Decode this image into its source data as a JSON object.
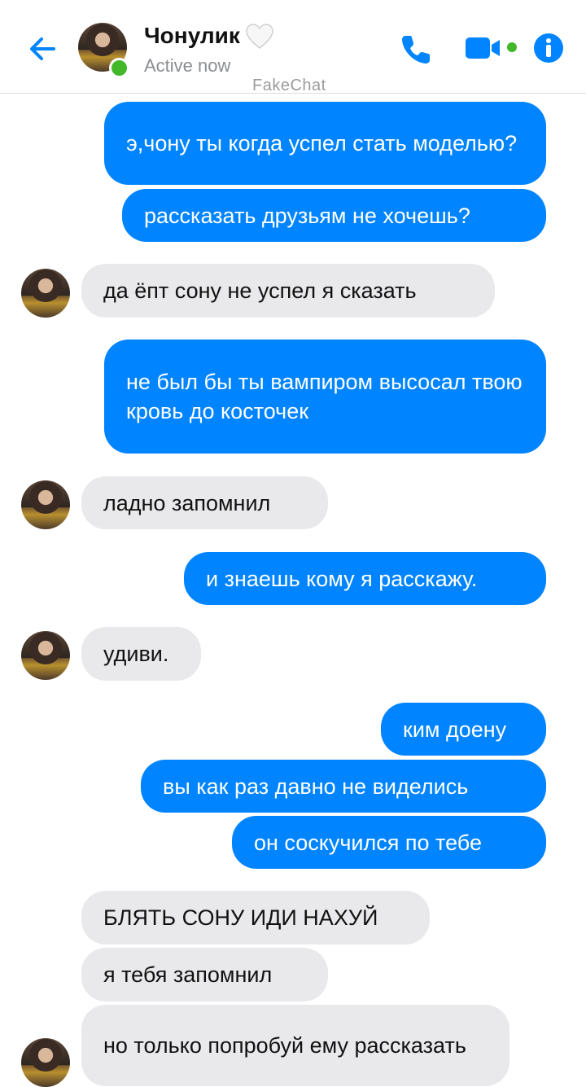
{
  "header": {
    "contact_name": "Чонулик",
    "status": "Active now"
  },
  "watermark": "FakeChat",
  "colors": {
    "accent": "#0084ff",
    "online": "#42b72a",
    "incoming_bubble": "#e9e9eb"
  },
  "messages": [
    {
      "direction": "out",
      "text": "э,чону ты когда успел стать моделью?"
    },
    {
      "direction": "out",
      "text": "рассказать друзьям не хочешь?"
    },
    {
      "direction": "in",
      "text": "да ёпт сону не успел я сказать"
    },
    {
      "direction": "out",
      "text": "не был бы ты вампиром высосал твою кровь до косточек"
    },
    {
      "direction": "in",
      "text": "ладно запомнил"
    },
    {
      "direction": "out",
      "text": "и знаешь кому я расскажу."
    },
    {
      "direction": "in",
      "text": "удиви."
    },
    {
      "direction": "out",
      "text": "ким доену"
    },
    {
      "direction": "out",
      "text": "вы как раз давно не виделись"
    },
    {
      "direction": "out",
      "text": "он соскучился по тебе"
    },
    {
      "direction": "in",
      "text": "БЛЯТЬ СОНУ ИДИ НАХУЙ"
    },
    {
      "direction": "in",
      "text": "я тебя запомнил"
    },
    {
      "direction": "in",
      "text": "но только попробуй ему рассказать"
    }
  ]
}
